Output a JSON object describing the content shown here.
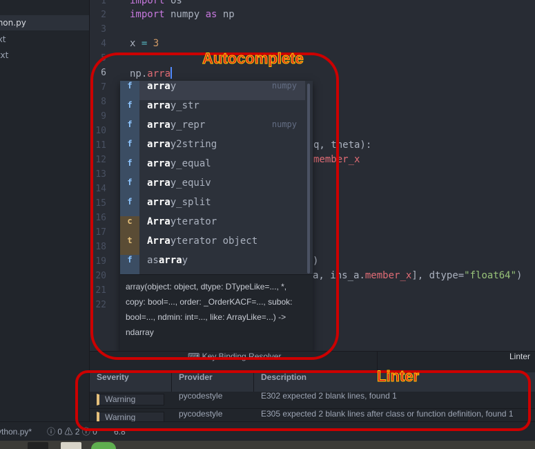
{
  "sidebar": {
    "files": [
      "thon.py",
      "txt",
      ".txt"
    ]
  },
  "editor": {
    "line_numbers": [
      "1",
      "2",
      "3",
      "4",
      "5",
      "6",
      "7",
      "8",
      "9",
      "10",
      "11",
      "12",
      "13",
      "14",
      "15",
      "16",
      "17",
      "18",
      "19",
      "20",
      "21",
      "22"
    ],
    "lines": {
      "l1": {
        "kw": "import",
        "rest": " os"
      },
      "l2": {
        "kw": "import",
        "mod": " numpy ",
        "as": "as",
        "alias": " np"
      },
      "l4": {
        "var": "x ",
        "op": "=",
        "val": " 3"
      },
      "l6": {
        "obj": "np.",
        "partial": "arra"
      },
      "l11": {
        "text": "q, theta):"
      },
      "l12": {
        "text": "member_x"
      },
      "l19": {
        "text": ")"
      },
      "l20": {
        "a": "a, ",
        "b": "ins_a.",
        "c": "member_x",
        "d": "], dtype=",
        "e": "\"float64\"",
        "f": ")"
      }
    }
  },
  "autocomplete": {
    "items": [
      {
        "type": "f",
        "pre": "",
        "match": "arra",
        "suffix": "y",
        "source": "numpy"
      },
      {
        "type": "f",
        "pre": "",
        "match": "arra",
        "suffix": "y_str",
        "source": ""
      },
      {
        "type": "f",
        "pre": "",
        "match": "arra",
        "suffix": "y_repr",
        "source": "numpy"
      },
      {
        "type": "f",
        "pre": "",
        "match": "arra",
        "suffix": "y2string",
        "source": ""
      },
      {
        "type": "f",
        "pre": "",
        "match": "arra",
        "suffix": "y_equal",
        "source": ""
      },
      {
        "type": "f",
        "pre": "",
        "match": "arra",
        "suffix": "y_equiv",
        "source": ""
      },
      {
        "type": "f",
        "pre": "",
        "match": "arra",
        "suffix": "y_split",
        "source": ""
      },
      {
        "type": "c",
        "pre": "",
        "match": "Arra",
        "suffix": "yterator",
        "source": ""
      },
      {
        "type": "t",
        "pre": "",
        "match": "Arra",
        "suffix": "yterator object",
        "source": ""
      },
      {
        "type": "f",
        "pre": "as",
        "match": "arra",
        "suffix": "y",
        "source": ""
      }
    ],
    "doc": "array(object: object, dtype: DTypeLike=..., *, copy: bool=..., order: _OrderKACF=..., subok: bool=..., ndmin: int=..., like: ArrayLike=...) -> ndarray"
  },
  "annotations": {
    "autocomplete": "Autocomplete",
    "linter": "Linter"
  },
  "panel": {
    "tabs": {
      "key_binding": "Key Binding Resolver",
      "linter": "Linter"
    },
    "headers": {
      "severity": "Severity",
      "provider": "Provider",
      "description": "Description"
    },
    "rows": [
      {
        "severity": "Warning",
        "provider": "pycodestyle",
        "description": "E302 expected 2 blank lines, found 1"
      },
      {
        "severity": "Warning",
        "provider": "pycodestyle",
        "description": "E305 expected 2 blank lines after class or function definition, found 1"
      }
    ]
  },
  "status": {
    "file": "ython.py*",
    "errors": "0",
    "warnings": "2",
    "infos": "0",
    "position": "6:8"
  },
  "colors": {
    "annotation": "#cc0000",
    "warning": "#e5c07b",
    "accent": "#528bff"
  }
}
